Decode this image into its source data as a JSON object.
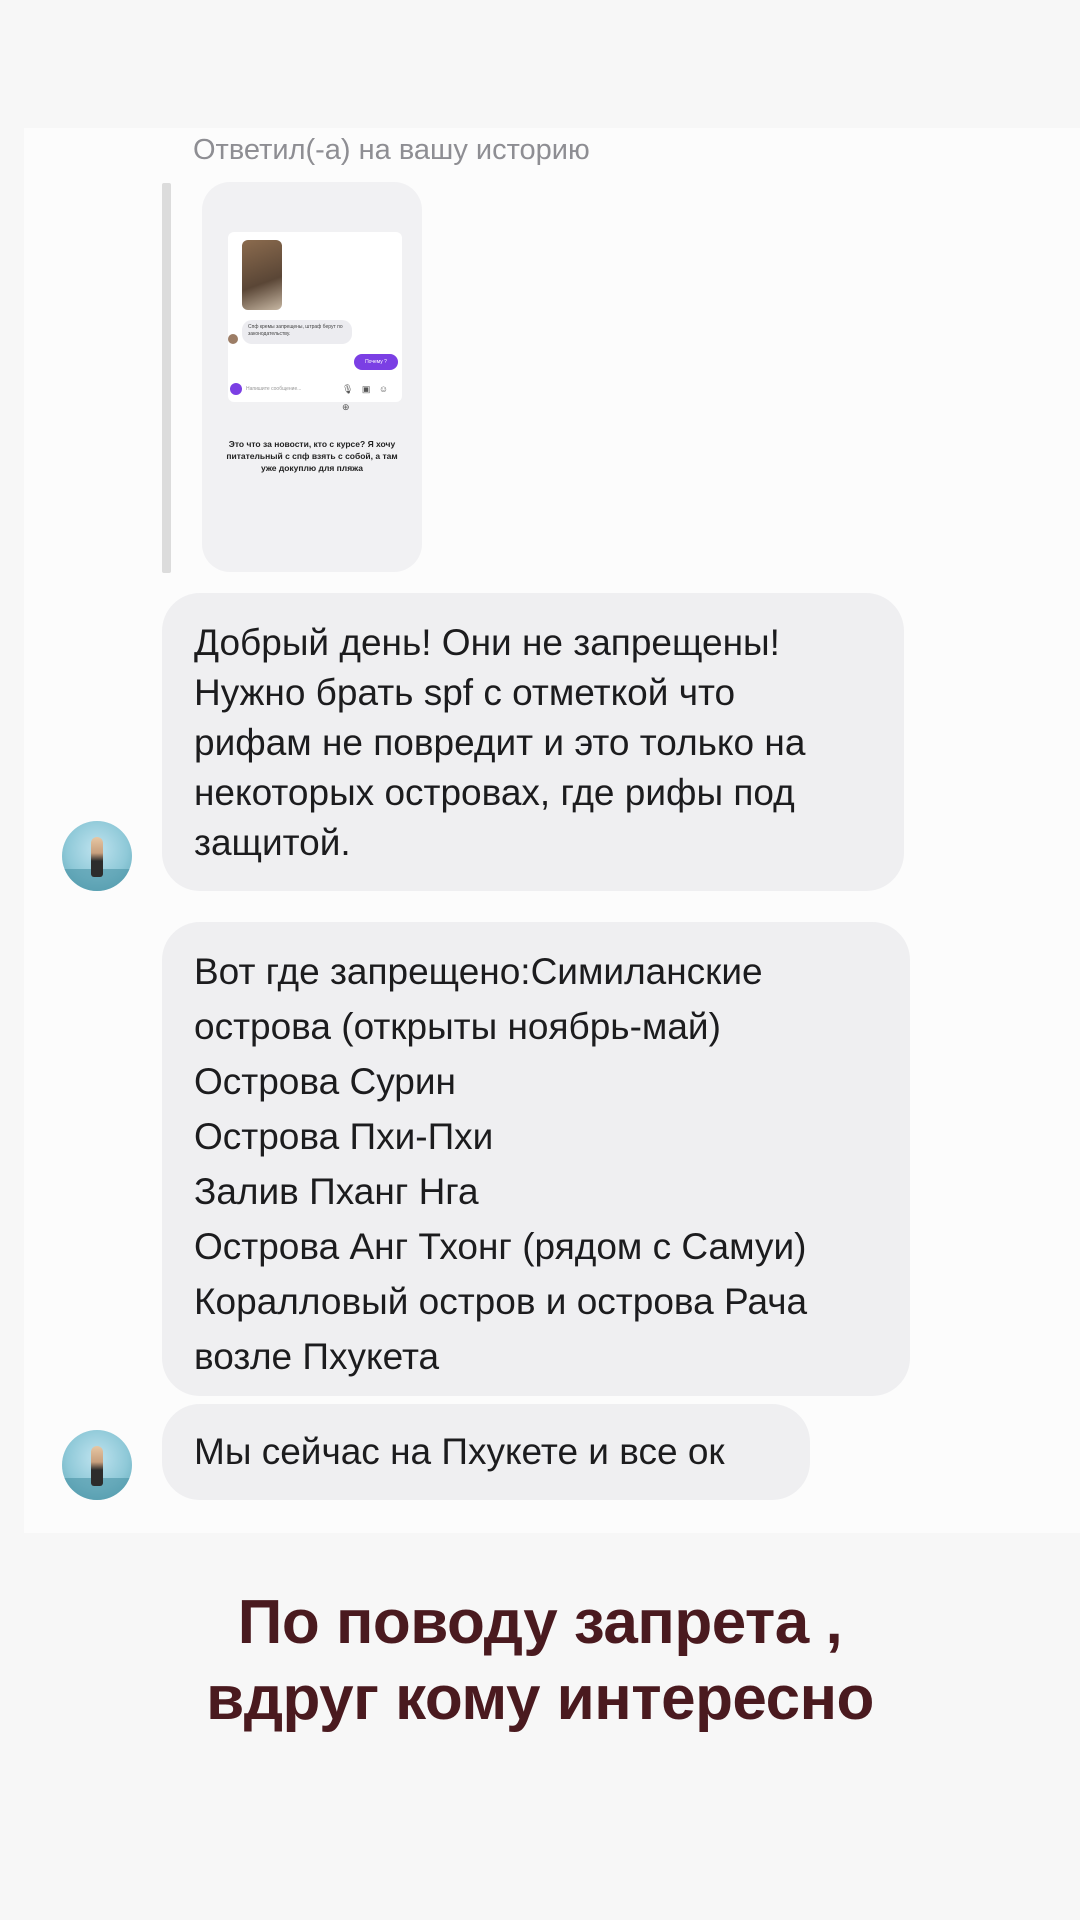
{
  "reply": {
    "header": "Ответил(-а) на вашу историю",
    "story": {
      "bubble_text": "Спф кремы запрещены, штраф берут по законодательству.",
      "purple_button": "Почему ?",
      "input_placeholder": "Напишите сообщение...",
      "input_icons": "🎙 ▣ ☺ ⊕",
      "caption": "Это что за новости, кто с курсе? Я хочу питательный с спф взять с собой, а там уже докуплю для пляжа"
    }
  },
  "messages": [
    {
      "text": "Добрый день! Они не запрещены!\nНужно брать spf с отметкой что\nрифам не повредит и это только на\nнекоторых островах, где рифы под\nзащитой."
    },
    {
      "lines": [
        "Вот где запрещено:Симиланские",
        "острова (открыты ноябрь-май)",
        "Острова Сурин",
        "Острова Пхи-Пхи",
        "Залив Пханг Нга",
        "Острова Анг Тхонг (рядом с Самуи)",
        "Коралловый остров и острова Рача",
        "возле Пхукета"
      ]
    },
    {
      "text": "Мы сейчас на Пхукете и все ок"
    }
  ],
  "caption": {
    "line1": "По поводу запрета ,",
    "line2": "вдруг кому интересно"
  }
}
